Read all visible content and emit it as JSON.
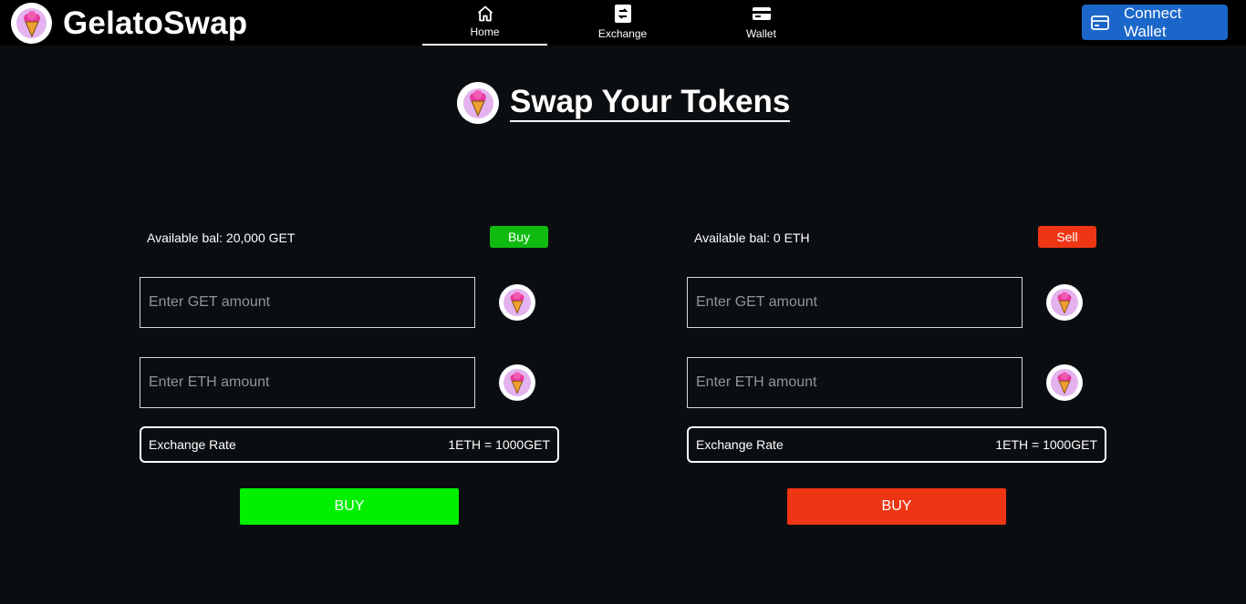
{
  "brand": {
    "name": "GelatoSwap",
    "logo_icon": "ice-cream-icon"
  },
  "nav": [
    {
      "label": "Home",
      "icon": "home-icon",
      "active": true
    },
    {
      "label": "Exchange",
      "icon": "exchange-icon",
      "active": false
    },
    {
      "label": "Wallet",
      "icon": "wallet-icon",
      "active": false
    }
  ],
  "connect_wallet": {
    "label": "Connect Wallet",
    "icon": "wallet-card-icon"
  },
  "page_title": "Swap Your Tokens",
  "panels": {
    "buy": {
      "balance": "Available bal: 20,000 GET",
      "tag_label": "Buy",
      "get_placeholder": "Enter GET amount",
      "eth_placeholder": "Enter ETH amount",
      "rate_label": "Exchange Rate",
      "rate_value": "1ETH = 1000GET",
      "action_label": "BUY"
    },
    "sell": {
      "balance": "Available bal: 0 ETH",
      "tag_label": "Sell",
      "get_placeholder": "Enter GET amount",
      "eth_placeholder": "Enter ETH amount",
      "rate_label": "Exchange Rate",
      "rate_value": "1ETH = 1000GET",
      "action_label": "BUY"
    }
  },
  "colors": {
    "background": "#0b0e11",
    "topbar": "#000000",
    "connect_button": "#1b66c9",
    "buy_tag": "#0fbb0f",
    "buy_action": "#00f000",
    "sell_red": "#ee3514",
    "logo_pink": "#e4b3ef"
  }
}
